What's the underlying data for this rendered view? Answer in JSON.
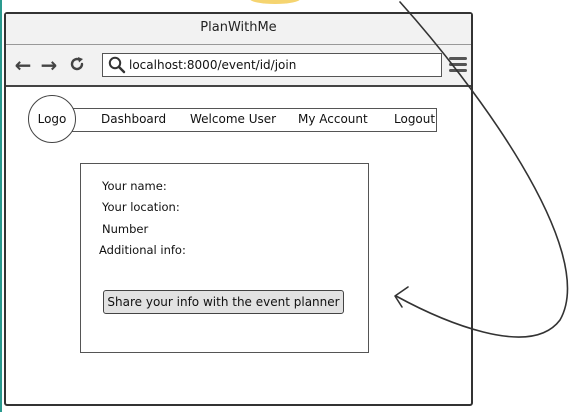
{
  "window": {
    "title": "PlanWithMe"
  },
  "toolbar": {
    "back_icon": "arrow-left-icon",
    "forward_icon": "arrow-right-icon",
    "reload_icon": "reload-icon",
    "url": "localhost:8000/event/id/join",
    "menu_icon": "hamburger-menu-icon"
  },
  "header": {
    "logo": "Logo",
    "nav": [
      "Dashboard",
      "Welcome User",
      "My Account",
      "Logout"
    ]
  },
  "form": {
    "labels": [
      "Your name:",
      "Your location:",
      "Number",
      "Additional info:"
    ],
    "submit_label": "Share your info with the event planner"
  },
  "colors": {
    "accent_edge": "#2a9a8e",
    "blob": "#f2c94c"
  }
}
